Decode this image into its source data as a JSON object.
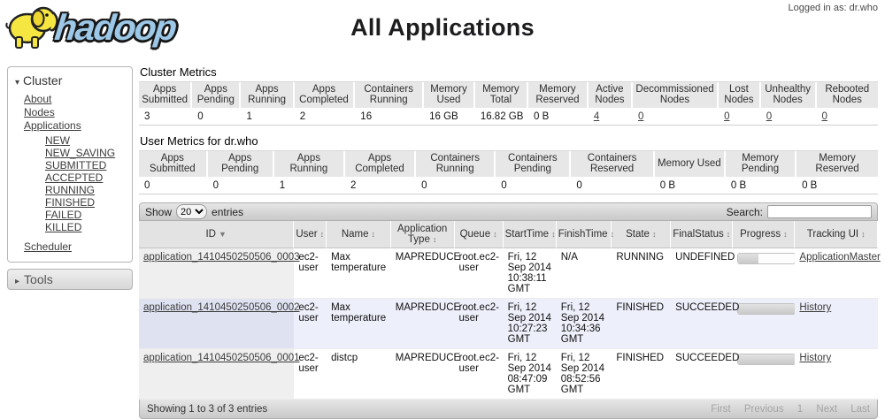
{
  "header": {
    "logged_in_as": "Logged in as: dr.who",
    "logo_text": "hadoop",
    "title": "All Applications"
  },
  "icons": {
    "expand": "▾",
    "collapse": "▸",
    "sort_desc": "▼",
    "sort_both": "↕"
  },
  "colors": {
    "logo_blue": "#9cc7e6",
    "row_stripe": "#edeffa",
    "header_gray": "#e3e3e3"
  },
  "sidebar": {
    "cluster_label": "Cluster",
    "items": [
      {
        "label": "About"
      },
      {
        "label": "Nodes"
      },
      {
        "label": "Applications"
      }
    ],
    "sub_items": [
      {
        "label": "NEW"
      },
      {
        "label": "NEW_SAVING"
      },
      {
        "label": "SUBMITTED"
      },
      {
        "label": "ACCEPTED"
      },
      {
        "label": "RUNNING"
      },
      {
        "label": "FINISHED"
      },
      {
        "label": "FAILED"
      },
      {
        "label": "KILLED"
      }
    ],
    "scheduler_label": "Scheduler",
    "tools_label": "Tools"
  },
  "cluster_metrics": {
    "title": "Cluster Metrics",
    "columns": [
      "Apps Submitted",
      "Apps Pending",
      "Apps Running",
      "Apps Completed",
      "Containers Running",
      "Memory Used",
      "Memory Total",
      "Memory Reserved",
      "Active Nodes",
      "Decommissioned Nodes",
      "Lost Nodes",
      "Unhealthy Nodes",
      "Rebooted Nodes"
    ],
    "values": [
      "3",
      "0",
      "1",
      "2",
      "16",
      "16 GB",
      "16.82 GB",
      "0 B",
      "4",
      "0",
      "0",
      "0",
      "0"
    ]
  },
  "user_metrics": {
    "title": "User Metrics for dr.who",
    "columns": [
      "Apps Submitted",
      "Apps Pending",
      "Apps Running",
      "Apps Completed",
      "Containers Running",
      "Containers Pending",
      "Containers Reserved",
      "Memory Used",
      "Memory Pending",
      "Memory Reserved"
    ],
    "values": [
      "0",
      "0",
      "1",
      "2",
      "0",
      "0",
      "0",
      "0 B",
      "0 B",
      "0 B"
    ]
  },
  "apps_table": {
    "show_label": "Show",
    "page_size": "20",
    "entries_label": "entries",
    "search_label": "Search:",
    "columns": [
      "ID",
      "User",
      "Name",
      "Application Type",
      "Queue",
      "StartTime",
      "FinishTime",
      "State",
      "FinalStatus",
      "Progress",
      "Tracking UI"
    ],
    "rows": [
      {
        "id": "application_1410450250506_0003",
        "user": "ec2-user",
        "name": "Max temperature",
        "type": "MAPREDUCE",
        "queue": "root.ec2-user",
        "start": "Fri, 12 Sep 2014 10:38:11 GMT",
        "finish": "N/A",
        "state": "RUNNING",
        "final_status": "UNDEFINED",
        "progress": 35,
        "tracking": "ApplicationMaster"
      },
      {
        "id": "application_1410450250506_0002",
        "user": "ec2-user",
        "name": "Max temperature",
        "type": "MAPREDUCE",
        "queue": "root.ec2-user",
        "start": "Fri, 12 Sep 2014 10:27:23 GMT",
        "finish": "Fri, 12 Sep 2014 10:34:36 GMT",
        "state": "FINISHED",
        "final_status": "SUCCEEDED",
        "progress": 100,
        "tracking": "History"
      },
      {
        "id": "application_1410450250506_0001",
        "user": "ec2-user",
        "name": "distcp",
        "type": "MAPREDUCE",
        "queue": "root.ec2-user",
        "start": "Fri, 12 Sep 2014 08:47:09 GMT",
        "finish": "Fri, 12 Sep 2014 08:52:56 GMT",
        "state": "FINISHED",
        "final_status": "SUCCEEDED",
        "progress": 100,
        "tracking": "History"
      }
    ],
    "footer": {
      "showing": "Showing 1 to 3 of 3 entries",
      "pagination": [
        "First",
        "Previous",
        "1",
        "Next",
        "Last"
      ]
    }
  }
}
